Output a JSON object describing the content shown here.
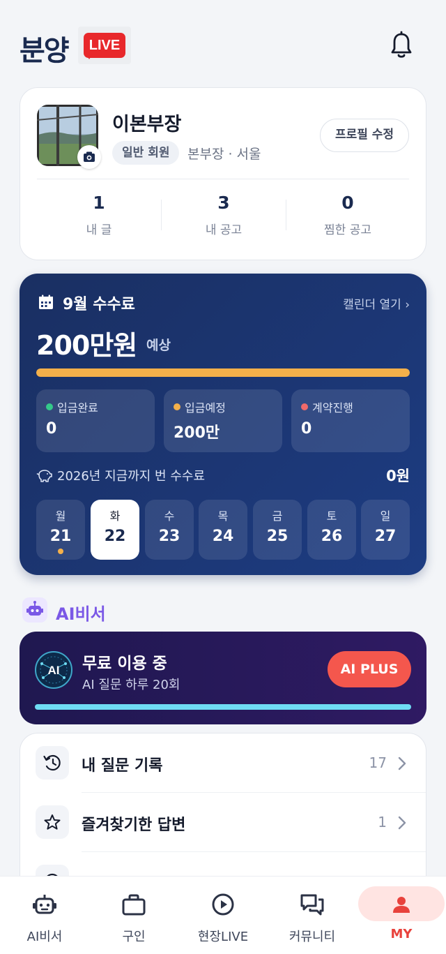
{
  "header": {
    "brand": "분양",
    "live_badge": "LIVE"
  },
  "profile": {
    "name": "이본부장",
    "grade": "일반 회원",
    "meta": "본부장 · 서울",
    "edit_label": "프로필 수정",
    "stats": [
      {
        "value": "1",
        "label": "내 글"
      },
      {
        "value": "3",
        "label": "내 공고"
      },
      {
        "value": "0",
        "label": "찜한 공고"
      }
    ]
  },
  "fee": {
    "title": "9월 수수료",
    "calendar_link": "캘린더 열기 ›",
    "amount": "200만원",
    "amount_suffix": "예상",
    "progress": 1.0,
    "statuses": [
      {
        "label": "입금완료",
        "value": "0",
        "color": "#34c98a"
      },
      {
        "label": "입금예정",
        "value": "200만",
        "color": "#f4b04a"
      },
      {
        "label": "계약진행",
        "value": "0",
        "color": "#f06a6a"
      }
    ],
    "ytd_label": "2026년 지금까지 번 수수료",
    "ytd_value": "0원",
    "week": [
      {
        "dow": "월",
        "date": "21",
        "marked": true
      },
      {
        "dow": "화",
        "date": "22",
        "active": true
      },
      {
        "dow": "수",
        "date": "23"
      },
      {
        "dow": "목",
        "date": "24"
      },
      {
        "dow": "금",
        "date": "25"
      },
      {
        "dow": "토",
        "date": "26"
      },
      {
        "dow": "일",
        "date": "27"
      }
    ]
  },
  "ai_section": {
    "title": "AI비서",
    "card": {
      "logo_text": "AI",
      "title": "무료 이용 중",
      "subtitle": "AI 질문 하루 20회",
      "plus_label": "AI PLUS"
    }
  },
  "menu": [
    {
      "label": "내 질문 기록",
      "count": "17",
      "icon": "history-icon"
    },
    {
      "label": "즐겨찾기한 답변",
      "count": "1",
      "icon": "star-icon"
    },
    {
      "label": "",
      "count": "",
      "icon": "info-icon"
    }
  ],
  "tabbar": [
    {
      "label": "AI비서",
      "icon": "robot-icon"
    },
    {
      "label": "구인",
      "icon": "briefcase-icon"
    },
    {
      "label": "현장LIVE",
      "icon": "play-icon"
    },
    {
      "label": "커뮤니티",
      "icon": "chat-icon"
    },
    {
      "label": "MY",
      "icon": "person-icon",
      "active": true
    }
  ],
  "colors": {
    "accent": "#1a2a4f",
    "live_red": "#e8282b",
    "ai_purple": "#7a58e6",
    "active_tab": "#e8423c"
  }
}
